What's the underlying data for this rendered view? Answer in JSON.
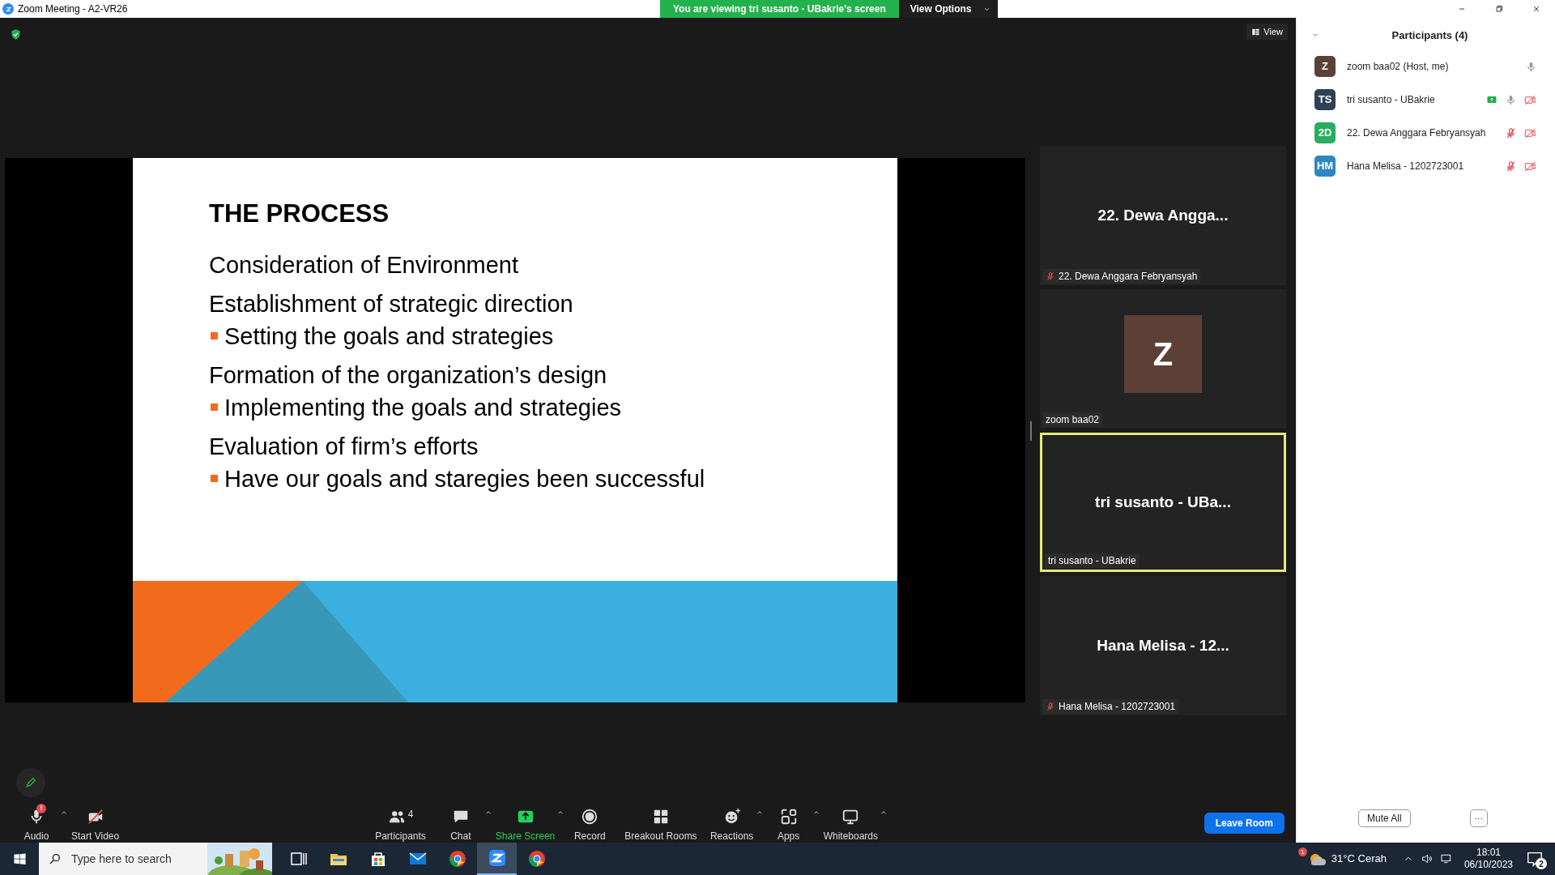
{
  "window": {
    "title": "Zoom Meeting - A2-VR26"
  },
  "banner": {
    "text": "You are viewing tri susanto - UBakrie's screen",
    "button": "View Options"
  },
  "view_button": "View",
  "slide": {
    "title": "THE PROCESS",
    "items": [
      {
        "kind": "heading",
        "text": "Consideration of Environment"
      },
      {
        "kind": "heading",
        "text": "Establishment of strategic direction"
      },
      {
        "kind": "bullet",
        "text": "Setting the goals and strategies"
      },
      {
        "kind": "heading",
        "text": "Formation of the organization’s design"
      },
      {
        "kind": "bullet",
        "text": "Implementing the goals and strategies"
      },
      {
        "kind": "heading",
        "text": "Evaluation of firm’s efforts"
      },
      {
        "kind": "bullet",
        "text": "Have our goals and staregies been successful"
      }
    ]
  },
  "video_tiles": [
    {
      "kind": "name",
      "display": "22. Dewa Angga...",
      "label": "22. Dewa Anggara Febryansyah",
      "muted": true,
      "active": false
    },
    {
      "kind": "avatar",
      "display": "Z",
      "label": "zoom baa02",
      "muted": false,
      "active": false
    },
    {
      "kind": "name",
      "display": "tri susanto - UBa...",
      "label": "tri susanto - UBakrie",
      "muted": false,
      "active": true
    },
    {
      "kind": "name",
      "display": "Hana Melisa - 12...",
      "label": "Hana Melisa - 1202723001",
      "muted": true,
      "active": false
    }
  ],
  "toolbar": {
    "left": [
      {
        "kind": "audio",
        "label": "Audio",
        "badge": "!",
        "caret": true,
        "selected": false
      },
      {
        "kind": "video",
        "label": "Start Video",
        "caret": false,
        "selected": false
      }
    ],
    "center": [
      {
        "kind": "participants",
        "label": "Participants",
        "count": "4",
        "caret": false,
        "selected": false
      },
      {
        "kind": "chat",
        "label": "Chat",
        "caret": true,
        "selected": false
      },
      {
        "kind": "share",
        "label": "Share Screen",
        "caret": true,
        "selected": true
      },
      {
        "kind": "record",
        "label": "Record",
        "caret": false,
        "selected": false
      },
      {
        "kind": "breakout",
        "label": "Breakout Rooms",
        "caret": false,
        "selected": false
      },
      {
        "kind": "reactions",
        "label": "Reactions",
        "caret": true,
        "selected": false
      },
      {
        "kind": "apps",
        "label": "Apps",
        "caret": true,
        "selected": false
      },
      {
        "kind": "whiteboards",
        "label": "Whiteboards",
        "caret": true,
        "selected": false
      }
    ],
    "leave_button": "Leave Room"
  },
  "participants_panel": {
    "title": "Participants (4)",
    "items": [
      {
        "initials": "Z",
        "name": "zoom baa02 (Host, me)",
        "color": "#5c4038",
        "sharing": false,
        "muted": false,
        "video_off": false
      },
      {
        "initials": "TS",
        "name": "tri susanto - UBakrie",
        "color": "#2f4156",
        "sharing": true,
        "muted": false,
        "video_off": true
      },
      {
        "initials": "2D",
        "name": "22. Dewa Anggara Febryansyah",
        "color": "#27ae60",
        "sharing": false,
        "muted": true,
        "video_off": true
      },
      {
        "initials": "HM",
        "name": "Hana Melisa - 1202723001",
        "color": "#2e86c1",
        "sharing": false,
        "muted": true,
        "video_off": true
      }
    ],
    "mute_all": "Mute All",
    "more": "···"
  },
  "taskbar": {
    "search_placeholder": "Type here to search",
    "weather_badge": "1",
    "weather": "31°C Cerah",
    "time": "18:01",
    "date": "06/10/2023",
    "notifications": "2",
    "apps": [
      {
        "kind": "taskview",
        "selected": false
      },
      {
        "kind": "explorer",
        "selected": false
      },
      {
        "kind": "store",
        "selected": false
      },
      {
        "kind": "mail",
        "selected": false
      },
      {
        "kind": "chrome",
        "selected": false
      },
      {
        "kind": "zoom",
        "selected": true
      },
      {
        "kind": "chrome",
        "selected": false
      }
    ]
  }
}
